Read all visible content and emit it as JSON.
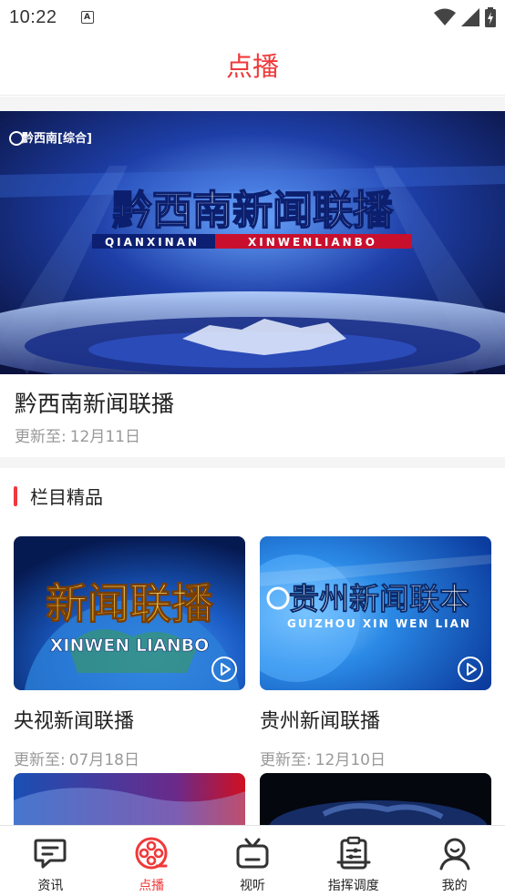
{
  "status_bar": {
    "time": "10:22",
    "notification_letter": "A"
  },
  "header": {
    "title": "点播"
  },
  "featured": {
    "title": "黔西南新闻联播",
    "update_prefix": "更新至:",
    "update_date": "12月11日",
    "logo_text": "黔西南[综合]",
    "banner_title": "黔西南新闻联播",
    "banner_subtitle_a": "QIANXINAN",
    "banner_subtitle_b": "XINWENLIANBO"
  },
  "section": {
    "title": "栏目精品"
  },
  "programs": [
    {
      "title": "央视新闻联播",
      "update_prefix": "更新至:",
      "update_date": "07月18日",
      "thumb_title": "新闻联播",
      "thumb_sub": "XINWEN LIANBO"
    },
    {
      "title": "贵州新闻联播",
      "update_prefix": "更新至:",
      "update_date": "12月10日",
      "thumb_title": "贵州新闻联本",
      "thumb_sub": "GUIZHOU XIN WEN LIAN"
    }
  ],
  "nav": [
    {
      "label": "资讯",
      "icon": "chat-icon",
      "active": false
    },
    {
      "label": "点播",
      "icon": "film-reel-icon",
      "active": true
    },
    {
      "label": "视听",
      "icon": "tv-icon",
      "active": false
    },
    {
      "label": "指挥调度",
      "icon": "dispatch-clipboard-icon",
      "active": false
    },
    {
      "label": "我的",
      "icon": "user-icon",
      "active": false
    }
  ],
  "colors": {
    "accent": "#f0393a",
    "text": "#222222",
    "muted": "#999999"
  }
}
